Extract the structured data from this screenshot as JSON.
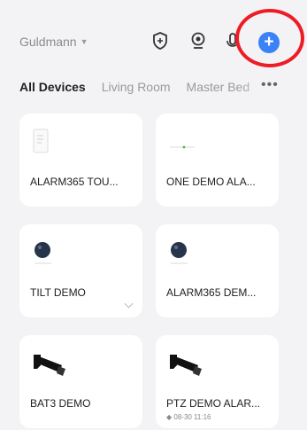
{
  "header": {
    "home_name": "Guldmann"
  },
  "tabs": [
    {
      "label": "All Devices"
    },
    {
      "label": "Living Room"
    },
    {
      "label": "Master Bed"
    }
  ],
  "more_label": "•••",
  "add_symbol": "+",
  "devices": [
    {
      "name": "ALARM365 TOU...",
      "icon": "alarm-panel-icon"
    },
    {
      "name": "ONE DEMO ALA...",
      "icon": "alarm-panel-icon"
    },
    {
      "name": "TILT DEMO",
      "icon": "dome-camera-icon"
    },
    {
      "name": "ALARM365 DEM...",
      "icon": "dome-camera-icon"
    },
    {
      "name": "BAT3 DEMO",
      "icon": "bullet-camera-icon"
    },
    {
      "name": "PTZ DEMO ALAR...",
      "icon": "bullet-camera-icon",
      "status": "08-30 11:16"
    }
  ],
  "colors": {
    "accent": "#3b82f6",
    "highlight": "#ee1c25",
    "background": "#f3f3f5"
  }
}
